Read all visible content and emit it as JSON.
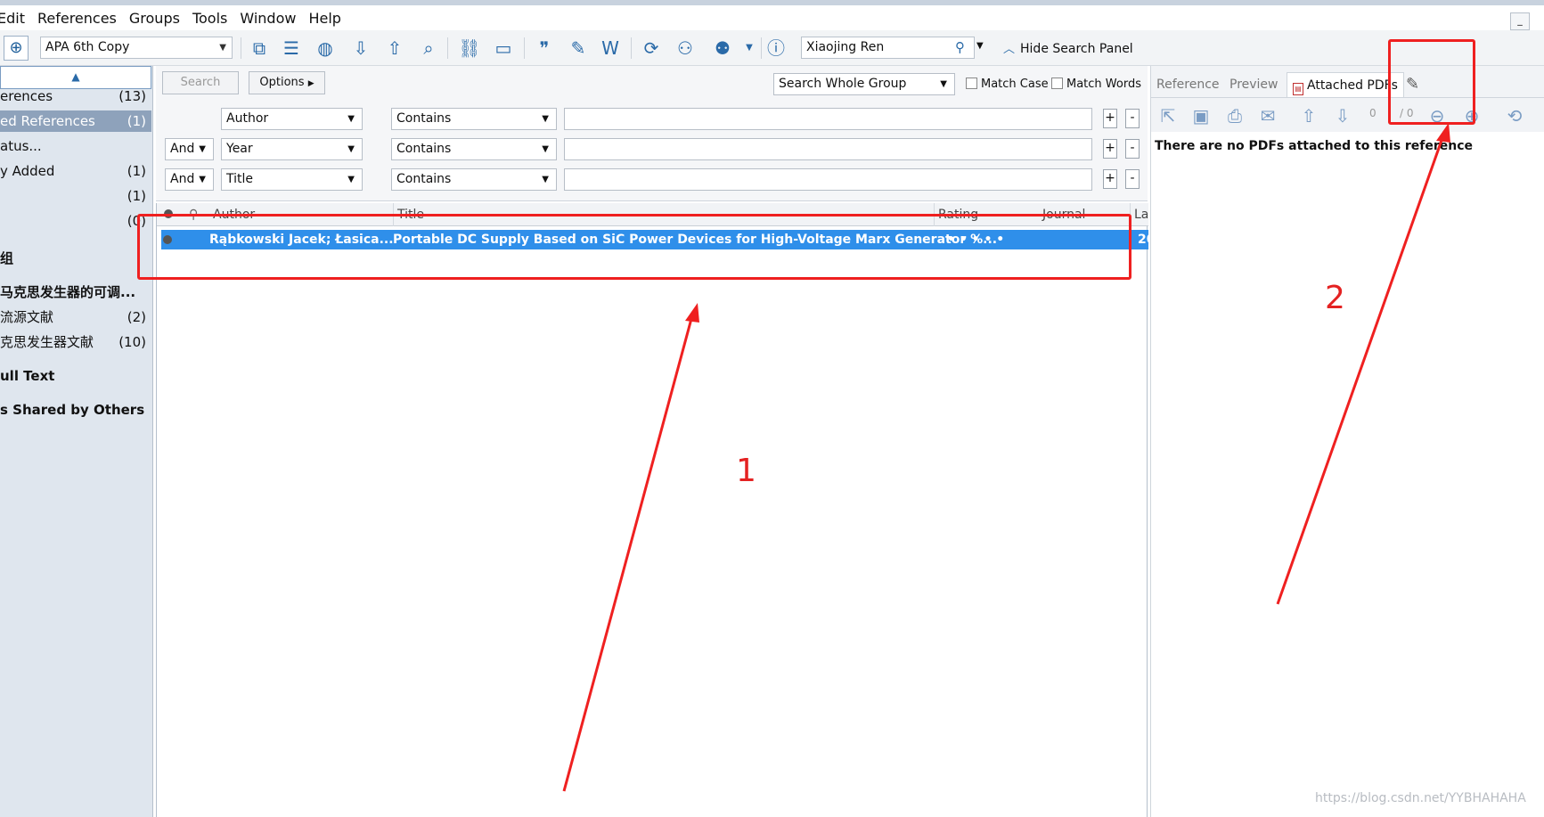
{
  "menu": [
    "Edit",
    "References",
    "Groups",
    "Tools",
    "Window",
    "Help"
  ],
  "window_minimize": "_",
  "toolbar": {
    "style": "APA 6th Copy",
    "user": "Xiaojing Ren",
    "hide_search_panel": "Hide Search Panel"
  },
  "groups": [
    {
      "label": "erences",
      "count": "(13)",
      "selected": false,
      "header": false
    },
    {
      "label": "ed References",
      "count": "(1)",
      "selected": true,
      "header": false
    },
    {
      "label": "atus...",
      "count": "",
      "selected": false,
      "header": false
    },
    {
      "label": "y Added",
      "count": "(1)",
      "selected": false,
      "header": false
    },
    {
      "label": "",
      "count": "(1)",
      "selected": false,
      "header": false
    },
    {
      "label": "",
      "count": "(0)",
      "selected": false,
      "header": false
    },
    {
      "label": "组",
      "count": "",
      "selected": false,
      "header": true
    },
    {
      "label": "马克思发生器的可调...",
      "count": "",
      "selected": false,
      "header": true
    },
    {
      "label": "流源文献",
      "count": "(2)",
      "selected": false,
      "header": false
    },
    {
      "label": "克思发生器文献",
      "count": "(10)",
      "selected": false,
      "header": false
    },
    {
      "label": "ull Text",
      "count": "",
      "selected": false,
      "header": true
    },
    {
      "label": "s Shared by Others",
      "count": "",
      "selected": false,
      "header": true
    }
  ],
  "search": {
    "search_button": "Search",
    "options_button": "Options",
    "scope": "Search Whole Group",
    "match_case": "Match Case",
    "match_words": "Match Words",
    "rows": [
      {
        "bool": "",
        "field": "Author",
        "op": "Contains"
      },
      {
        "bool": "And",
        "field": "Year",
        "op": "Contains"
      },
      {
        "bool": "And",
        "field": "Title",
        "op": "Contains"
      }
    ],
    "plus": "+",
    "minus": "-"
  },
  "list": {
    "columns": [
      "Author",
      "Title",
      "Rating",
      "Journal",
      "La"
    ],
    "rows": [
      {
        "author": "Rąbkowski Jacek; Łasica...",
        "title": "Portable DC Supply Based on SiC Power Devices for High-Voltage Marx Generator %...",
        "rating": "•  •  •  •  •",
        "journal": "",
        "last": "20"
      }
    ]
  },
  "right_panel": {
    "tabs": [
      "Reference",
      "Preview",
      "Attached PDFs"
    ],
    "page_current": "0",
    "page_total": "/ 0",
    "empty_message": "There are no PDFs attached to this reference"
  },
  "annotations": {
    "label1": "1",
    "label2": "2",
    "color": "#ef2020"
  },
  "watermark": "https://blog.csdn.net/YYBHAHAHA"
}
